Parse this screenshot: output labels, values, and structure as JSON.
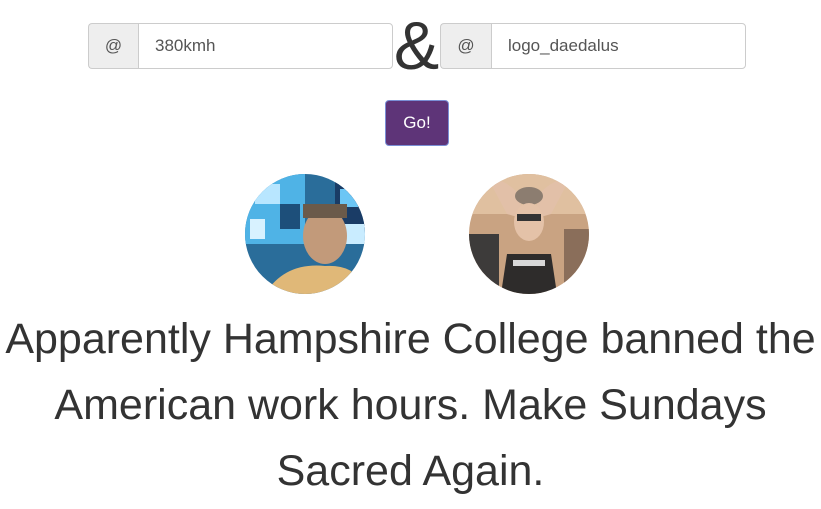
{
  "form": {
    "left": {
      "addon": "@",
      "value": "380kmh"
    },
    "right": {
      "addon": "@",
      "value": "logo_daedalus"
    },
    "ampersand": "&",
    "go_label": "Go!"
  },
  "avatars": {
    "left_name": "avatar-380kmh",
    "right_name": "avatar-logo_daedalus"
  },
  "tweet": {
    "text": "Apparently Hampshire College banned the American work hours. Make Sundays Sacred Again."
  },
  "colors": {
    "button_bg": "#5e3478",
    "text": "#333333",
    "addon_bg": "#eeeeee"
  }
}
